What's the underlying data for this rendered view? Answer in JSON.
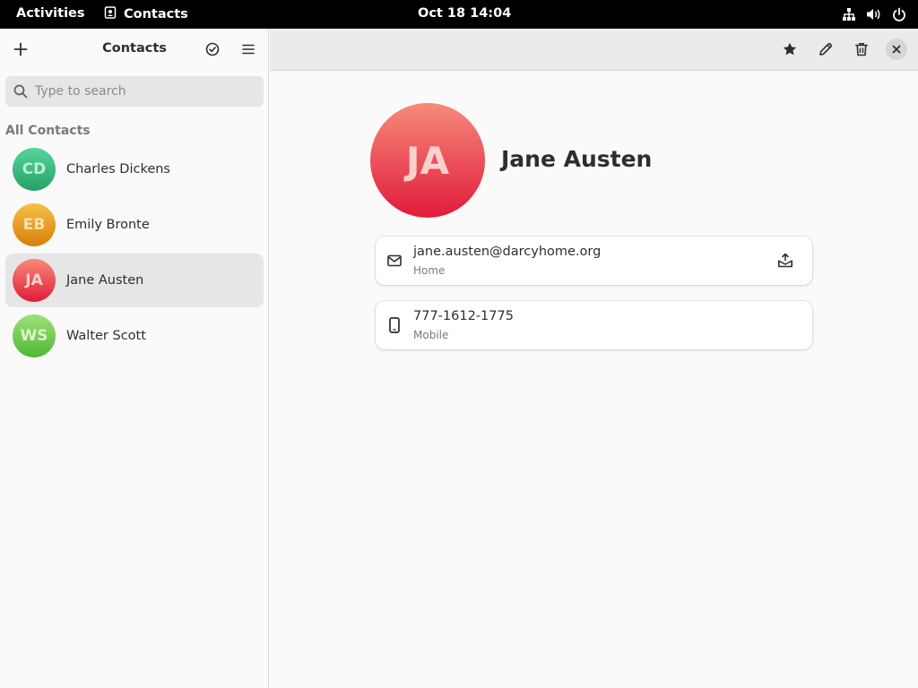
{
  "topbar": {
    "activities": "Activities",
    "app_name": "Contacts",
    "clock": "Oct 18  14:04",
    "tray_icons": [
      "network-icon",
      "volume-icon",
      "power-icon"
    ]
  },
  "sidebar": {
    "title": "Contacts",
    "search_placeholder": "Type to search",
    "section_label": "All Contacts",
    "contacts": [
      {
        "initials": "CD",
        "name": "Charles Dickens",
        "color_top": "#57d49a",
        "color_bottom": "#26a269",
        "text_color": "#bfeed6",
        "selected": false
      },
      {
        "initials": "EB",
        "name": "Emily Bronte",
        "color_top": "#f6c04a",
        "color_bottom": "#d8800a",
        "text_color": "#fbe1ad",
        "selected": false
      },
      {
        "initials": "JA",
        "name": "Jane Austen",
        "color_top": "#f78a7a",
        "color_bottom": "#e01b3a",
        "text_color": "#fcd0cc",
        "selected": true
      },
      {
        "initials": "WS",
        "name": "Walter Scott",
        "color_top": "#9ee07a",
        "color_bottom": "#4fb833",
        "text_color": "#ddf5cc",
        "selected": false
      }
    ]
  },
  "detail": {
    "initials": "JA",
    "name": "Jane Austen",
    "email": {
      "value": "jane.austen@darcyhome.org",
      "type": "Home"
    },
    "phone": {
      "value": "777-1612-1775",
      "type": "Mobile"
    }
  }
}
